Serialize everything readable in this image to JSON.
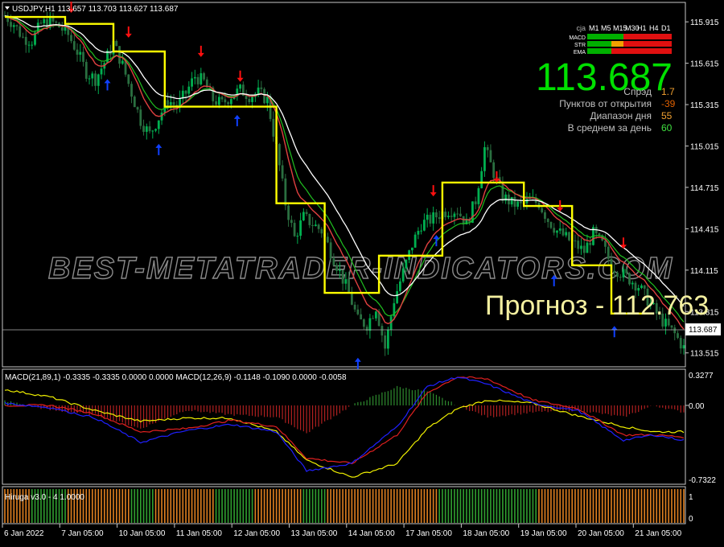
{
  "header": {
    "symbol_line": "USDJPY,H1  113.657 113.703 113.627 113.687"
  },
  "colors": {
    "background": "#000000",
    "grid": "#c8c8c8",
    "bull": "#00b050",
    "bear": "#2a6f40",
    "ma_fast": "#e04040",
    "ma_slow": "#ffffff",
    "ma_green": "#20c020",
    "stair": "#ffff00",
    "arrow_up": "#1040ff",
    "arrow_down": "#ff1010",
    "macd_blue": "#2020ff",
    "macd_red": "#e02020",
    "macd_yellow": "#f0f000",
    "hist_green": "#2e8b2e",
    "hist_red": "#b02020",
    "hiruga_green": "#30a030",
    "hiruga_orange": "#e08020",
    "price_big": "#00e000",
    "info_label": "#c0c0c0",
    "info_orange": "#e06000",
    "info_orange_light": "#f0a030",
    "info_green": "#40e040",
    "forecast": "#f4f0a0"
  },
  "info_panel": {
    "timeframes_label": "cja",
    "timeframes": [
      "M1",
      "M5",
      "M15",
      "M30",
      "H1",
      "H4",
      "D1"
    ],
    "rows": [
      {
        "label": "MACD",
        "cells": [
          "green",
          "green",
          "green",
          "red",
          "red",
          "red",
          "red"
        ]
      },
      {
        "label": "STR",
        "cells": [
          "green",
          "green",
          "orange",
          "red",
          "red",
          "red",
          "red"
        ]
      },
      {
        "label": "EMA",
        "cells": [
          "green",
          "green",
          "red",
          "red",
          "red",
          "red",
          "red"
        ]
      }
    ],
    "big_price": "113.687",
    "stats": [
      {
        "label": "Спрэд",
        "value": "1.7",
        "color": "orange_light"
      },
      {
        "label": "Пунктов от открытия",
        "value": "-39",
        "color": "orange"
      },
      {
        "label": "Диапазон дня",
        "value": "55",
        "color": "orange_light"
      },
      {
        "label": "В среднем за день",
        "value": "60",
        "color": "green"
      }
    ]
  },
  "watermark": "BEST-METATRADER-INDICATORS.COM",
  "forecast_text": "Прогноз - 112.763",
  "current_price_label": "113.687",
  "macd_panel": {
    "label": "MACD(21,89,1) -0.3335 -0.3335 0.0000 0.0000  MACD(12,26,9) -0.1148 -0.1090 0.0000 -0.0058",
    "tick_labels": [
      "0.3277",
      "0.00",
      "-0.7322"
    ]
  },
  "hiruga_panel": {
    "label": "Hiruga v3.0 - 4 1.0000",
    "tick_labels": [
      "1",
      "0"
    ]
  },
  "x_axis_labels": [
    "6 Jan 2022",
    "7 Jan 05:00",
    "10 Jan 05:00",
    "11 Jan 05:00",
    "12 Jan 05:00",
    "13 Jan 05:00",
    "14 Jan 05:00",
    "17 Jan 05:00",
    "18 Jan 05:00",
    "19 Jan 05:00",
    "20 Jan 05:00",
    "21 Jan 05:00"
  ],
  "chart_data": {
    "type": "candlestick",
    "symbol": "USDJPY",
    "timeframe": "H1",
    "ohlc_last": {
      "open": 113.657,
      "high": 113.703,
      "low": 113.627,
      "close": 113.687
    },
    "y_ticks": [
      115.915,
      115.615,
      115.315,
      115.015,
      114.715,
      114.415,
      114.115,
      113.815,
      113.515
    ],
    "ylim": [
      113.42,
      116.05
    ],
    "x_labels": [
      "6 Jan 2022",
      "7 Jan 05:00",
      "10 Jan 05:00",
      "11 Jan 05:00",
      "12 Jan 05:00",
      "13 Jan 05:00",
      "14 Jan 05:00",
      "17 Jan 05:00",
      "18 Jan 05:00",
      "19 Jan 05:00",
      "20 Jan 05:00",
      "21 Jan 05:00"
    ],
    "price_path": [
      [
        0,
        115.96
      ],
      [
        3,
        115.9
      ],
      [
        6,
        115.8
      ],
      [
        9,
        115.78
      ],
      [
        12,
        115.9
      ],
      [
        15,
        115.92
      ],
      [
        18,
        115.88
      ],
      [
        21,
        115.82
      ],
      [
        24,
        115.7
      ],
      [
        27,
        115.55
      ],
      [
        30,
        115.5
      ],
      [
        33,
        115.62
      ],
      [
        36,
        115.76
      ],
      [
        39,
        115.6
      ],
      [
        42,
        115.4
      ],
      [
        45,
        115.2
      ],
      [
        48,
        115.1
      ],
      [
        51,
        115.22
      ],
      [
        54,
        115.35
      ],
      [
        57,
        115.3
      ],
      [
        60,
        115.4
      ],
      [
        63,
        115.52
      ],
      [
        66,
        115.48
      ],
      [
        69,
        115.35
      ],
      [
        72,
        115.32
      ],
      [
        75,
        115.38
      ],
      [
        78,
        115.42
      ],
      [
        81,
        115.38
      ],
      [
        84,
        115.4
      ],
      [
        87,
        115.35
      ],
      [
        90,
        115.0
      ],
      [
        93,
        114.6
      ],
      [
        96,
        114.35
      ],
      [
        99,
        114.5
      ],
      [
        102,
        114.45
      ],
      [
        105,
        114.4
      ],
      [
        108,
        114.25
      ],
      [
        111,
        114.1
      ],
      [
        114,
        113.95
      ],
      [
        117,
        113.75
      ],
      [
        120,
        113.72
      ],
      [
        123,
        113.85
      ],
      [
        126,
        113.55
      ],
      [
        129,
        113.9
      ],
      [
        132,
        114.1
      ],
      [
        135,
        114.3
      ],
      [
        138,
        114.45
      ],
      [
        141,
        114.48
      ],
      [
        144,
        114.52
      ],
      [
        147,
        114.55
      ],
      [
        150,
        114.55
      ],
      [
        153,
        114.45
      ],
      [
        156,
        114.62
      ],
      [
        159,
        115.0
      ],
      [
        162,
        114.82
      ],
      [
        165,
        114.65
      ],
      [
        168,
        114.6
      ],
      [
        171,
        114.58
      ],
      [
        174,
        114.62
      ],
      [
        177,
        114.6
      ],
      [
        180,
        114.48
      ],
      [
        183,
        114.4
      ],
      [
        186,
        114.35
      ],
      [
        189,
        114.3
      ],
      [
        192,
        114.25
      ],
      [
        195,
        114.38
      ],
      [
        198,
        114.3
      ],
      [
        201,
        114.15
      ],
      [
        204,
        114.1
      ],
      [
        207,
        114.05
      ],
      [
        210,
        114.0
      ],
      [
        213,
        113.9
      ],
      [
        216,
        113.8
      ],
      [
        219,
        113.72
      ],
      [
        222,
        113.65
      ],
      [
        225,
        113.55
      ]
    ],
    "stair_levels": [
      [
        0,
        115.95
      ],
      [
        20,
        115.95
      ],
      [
        20,
        115.9
      ],
      [
        36,
        115.9
      ],
      [
        36,
        115.7
      ],
      [
        53,
        115.7
      ],
      [
        53,
        115.3
      ],
      [
        90,
        115.3
      ],
      [
        90,
        114.6
      ],
      [
        106,
        114.6
      ],
      [
        106,
        113.95
      ],
      [
        124,
        113.95
      ],
      [
        124,
        114.22
      ],
      [
        145,
        114.22
      ],
      [
        145,
        114.75
      ],
      [
        162,
        114.75
      ],
      [
        162,
        114.75
      ],
      [
        172,
        114.75
      ],
      [
        172,
        114.58
      ],
      [
        188,
        114.58
      ],
      [
        188,
        114.15
      ],
      [
        201,
        114.15
      ],
      [
        201,
        113.8
      ],
      [
        212,
        113.8
      ]
    ],
    "arrows_down": [
      [
        22,
        115.98
      ],
      [
        41,
        115.8
      ],
      [
        65,
        115.66
      ],
      [
        78,
        115.48
      ],
      [
        142,
        114.65
      ],
      [
        163,
        114.75
      ],
      [
        184,
        114.54
      ],
      [
        205,
        114.27
      ]
    ],
    "arrows_up": [
      [
        34,
        115.5
      ],
      [
        51,
        115.03
      ],
      [
        77,
        115.24
      ],
      [
        117,
        113.48
      ],
      [
        143,
        114.37
      ],
      [
        182,
        114.08
      ],
      [
        202,
        113.71
      ]
    ],
    "series": [
      {
        "name": "MACD(21,89,1)",
        "panel": "macd"
      },
      {
        "name": "MACD(12,26,9)",
        "panel": "macd"
      },
      {
        "name": "Hiruga v3.0",
        "panel": "hiruga"
      }
    ],
    "macd_ylim": [
      -0.7322,
      0.3277
    ],
    "macd_blue": [
      [
        0,
        0.02
      ],
      [
        15,
        -0.02
      ],
      [
        30,
        -0.12
      ],
      [
        45,
        -0.35
      ],
      [
        60,
        -0.24
      ],
      [
        75,
        -0.18
      ],
      [
        90,
        -0.25
      ],
      [
        100,
        -0.62
      ],
      [
        115,
        -0.55
      ],
      [
        130,
        -0.2
      ],
      [
        140,
        0.18
      ],
      [
        150,
        0.27
      ],
      [
        160,
        0.2
      ],
      [
        175,
        0.02
      ],
      [
        190,
        -0.05
      ],
      [
        205,
        -0.33
      ],
      [
        215,
        -0.28
      ],
      [
        225,
        -0.33
      ]
    ],
    "macd_red": [
      [
        0,
        0.0
      ],
      [
        15,
        0.0
      ],
      [
        30,
        -0.08
      ],
      [
        45,
        -0.25
      ],
      [
        60,
        -0.22
      ],
      [
        75,
        -0.14
      ],
      [
        90,
        -0.2
      ],
      [
        100,
        -0.5
      ],
      [
        115,
        -0.55
      ],
      [
        130,
        -0.28
      ],
      [
        140,
        0.12
      ],
      [
        150,
        0.27
      ],
      [
        160,
        0.25
      ],
      [
        175,
        0.05
      ],
      [
        190,
        -0.03
      ],
      [
        205,
        -0.28
      ],
      [
        215,
        -0.28
      ],
      [
        225,
        -0.3
      ]
    ],
    "macd_yellow": [
      [
        0,
        0.15
      ],
      [
        15,
        0.08
      ],
      [
        30,
        -0.05
      ],
      [
        45,
        -0.15
      ],
      [
        60,
        -0.12
      ],
      [
        75,
        -0.12
      ],
      [
        90,
        -0.25
      ],
      [
        100,
        -0.52
      ],
      [
        115,
        -0.68
      ],
      [
        130,
        -0.55
      ],
      [
        140,
        -0.22
      ],
      [
        150,
        -0.03
      ],
      [
        160,
        0.05
      ],
      [
        175,
        0.02
      ],
      [
        190,
        -0.1
      ],
      [
        205,
        -0.2
      ],
      [
        215,
        -0.25
      ],
      [
        225,
        -0.25
      ]
    ],
    "hiruga_pattern": [
      "o",
      "o",
      "g",
      "g",
      "g",
      "o",
      "o",
      "o",
      "o",
      "o",
      "g",
      "g",
      "o",
      "o",
      "o",
      "o",
      "o",
      "g",
      "g",
      "g",
      "o",
      "o",
      "o",
      "o",
      "g",
      "g",
      "o",
      "o",
      "o",
      "o",
      "o",
      "o",
      "o",
      "o",
      "o",
      "g",
      "g",
      "g",
      "g",
      "g",
      "g",
      "g",
      "g",
      "o",
      "o",
      "o",
      "o",
      "o",
      "o",
      "o",
      "o",
      "o",
      "o",
      "o",
      "o"
    ]
  }
}
